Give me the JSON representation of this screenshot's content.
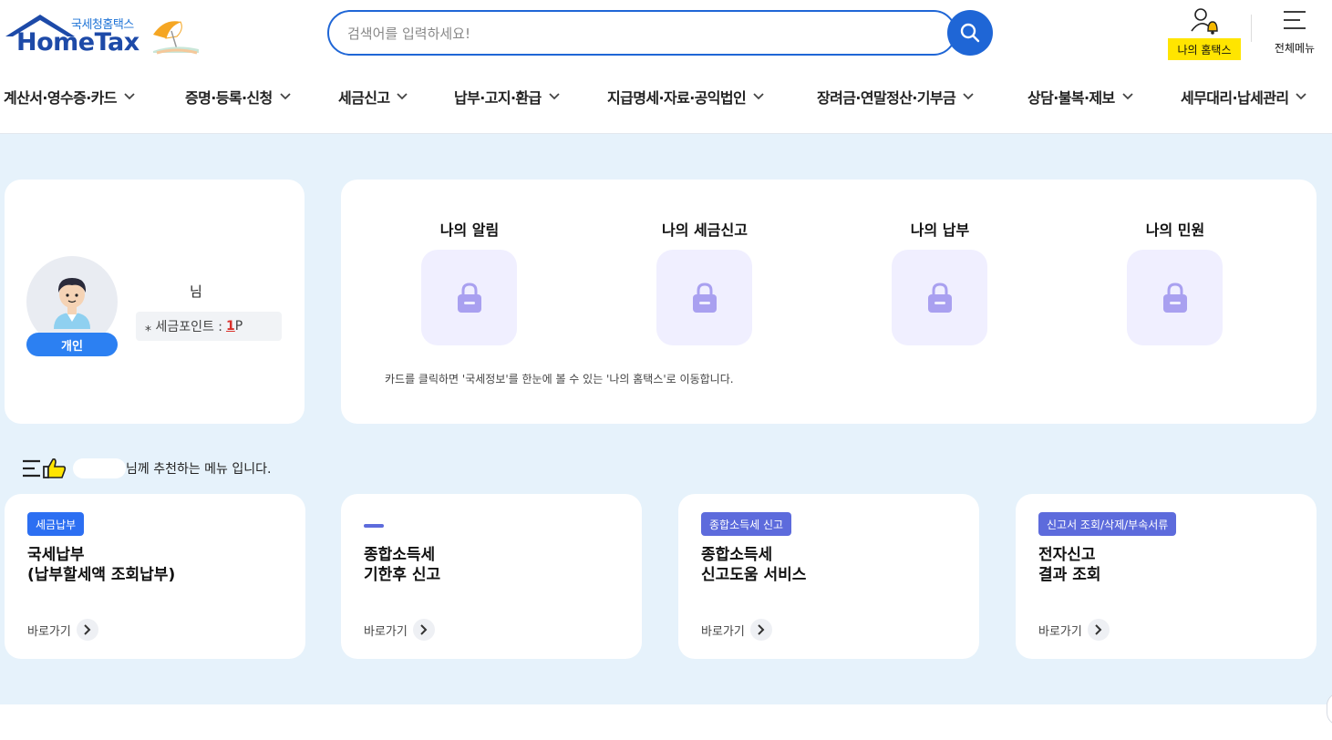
{
  "header": {
    "logo_sub": "국세청홈택스",
    "logo_main": "HomeTax",
    "search_placeholder": "검색어를 입력하세요!",
    "my_hometax_label": "나의 홈택스",
    "all_menu_label": "전체메뉴",
    "icons": {
      "search": "search-icon",
      "user_bell": "user-bell-icon",
      "menu": "hamburger-menu-icon"
    },
    "colors": {
      "primary": "#1f66d6",
      "highlight": "#ffe500"
    }
  },
  "gnb": [
    {
      "label": "계산서·영수증·카드"
    },
    {
      "label": "증명·등록·신청"
    },
    {
      "label": "세금신고"
    },
    {
      "label": "납부·고지·환급"
    },
    {
      "label": "지급명세·자료·공익법인"
    },
    {
      "label": "장려금·연말정산·기부금"
    },
    {
      "label": "상담·불복·제보"
    },
    {
      "label": "세무대리·납세관리"
    }
  ],
  "profile": {
    "nim": "님",
    "badge": "개인",
    "point_label": "⁎ 세금포인트 :",
    "point_value": "1",
    "point_unit": "P"
  },
  "quick": {
    "items": [
      {
        "title": "나의 알림"
      },
      {
        "title": "나의 세금신고"
      },
      {
        "title": "나의 납부"
      },
      {
        "title": "나의 민원"
      }
    ],
    "note": "카드를 클릭하면 '국세정보'를 한눈에 볼 수 있는 '나의 홈택스'로 이동합니다.",
    "lock_color": "#a9a0f0"
  },
  "recommend": {
    "text": "님께 추천하는 메뉴 입니다.",
    "link_label": "바로가기",
    "cards": [
      {
        "tag": "세금납부",
        "title": "국세납부\n(납부할세액 조회납부)"
      },
      {
        "tag": "",
        "title": "종합소득세\n기한후 신고"
      },
      {
        "tag": "종합소득세 신고",
        "title": "종합소득세\n신고도움 서비스"
      },
      {
        "tag": "신고서 조회/삭제/부속서류",
        "title": "전자신고\n결과 조회"
      }
    ]
  }
}
